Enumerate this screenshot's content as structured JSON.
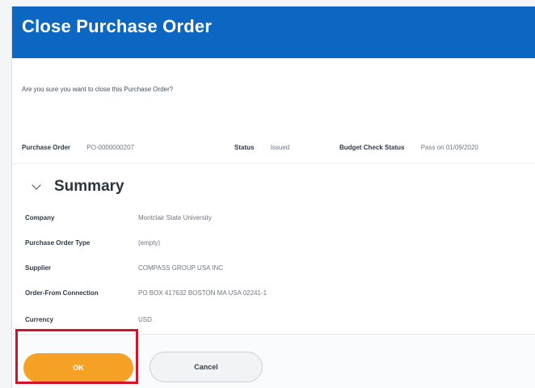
{
  "dialog": {
    "title": "Close Purchase Order",
    "confirm_text": "Are you sure you want to close this Purchase Order?",
    "colors": {
      "header": "#0b67c2",
      "ok_button": "#f5a125",
      "highlight": "#d2142a"
    }
  },
  "meta": {
    "purchase_order_label": "Purchase Order",
    "purchase_order_value": "PO-0000000207",
    "status_label": "Status",
    "status_value": "Issued",
    "budget_label": "Budget Check Status",
    "budget_value": "Pass on 01/09/2020"
  },
  "summary": {
    "icon": "chevron-down-icon",
    "title": "Summary",
    "fields": [
      {
        "label": "Company",
        "value": "Montclair State University"
      },
      {
        "label": "Purchase Order Type",
        "value": "(empty)"
      },
      {
        "label": "Supplier",
        "value": "COMPASS GROUP USA INC"
      },
      {
        "label": "Order-From Connection",
        "value": "PO BOX 417632 BOSTON MA USA 02241-1"
      },
      {
        "label": "Currency",
        "value": "USD"
      }
    ]
  },
  "footer": {
    "ok_label": "OK",
    "cancel_label": "Cancel"
  }
}
